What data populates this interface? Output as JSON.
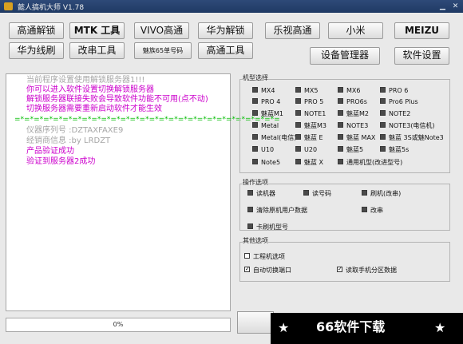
{
  "window": {
    "title": "懿人搞机大师 V1.78",
    "controls": [
      "minimize-icon",
      "close-icon"
    ]
  },
  "toolbar_row1": [
    "高通解锁",
    "MTK 工具",
    "VIVO高通",
    "华为解锁",
    "乐视高通",
    "小米",
    "MEIZU"
  ],
  "toolbar_row2": [
    "华为线刷",
    "改串工具",
    "魅族65单号码",
    "高通工具"
  ],
  "right_buttons": {
    "device_manager": "设备管理器",
    "settings": "软件设置"
  },
  "log": {
    "lines": [
      {
        "text": "当前程序设置使用解锁服务器1!!!",
        "color": "#a6a6a6"
      },
      {
        "text": "你可以进入软件设置切换解锁服务器",
        "color": "#cc00cc"
      },
      {
        "text": "解锁服务器联接失败会导致软件功能不可用(点不动)",
        "color": "#cc00cc"
      },
      {
        "text": "切换服务器需要重新启动软件才能生效",
        "color": "#cc00cc"
      },
      {
        "text": "=*=*=*=*=*=*=*=*=*=*=*=*=*=*=*=*=*=*=*=*=*=*=*=*=*=*=*=",
        "color": "#00bb00"
      },
      {
        "text": "仪器序列号   :DZTAXFAXE9",
        "color": "#a6a6a6"
      },
      {
        "text": "经销商信息   :by LRDZT",
        "color": "#a6a6a6"
      },
      {
        "text": "产品验证成功",
        "color": "#cc00cc"
      },
      {
        "text": "验证到服务器2成功",
        "color": "#cc00cc"
      }
    ]
  },
  "progress": {
    "label": "0%",
    "value": 0
  },
  "groups": {
    "models": {
      "label": "机型选择",
      "rows": [
        [
          "MX4",
          "MX5",
          "MX6",
          "PRO 6"
        ],
        [
          "PRO 4",
          "PRO 5",
          "PRO6s",
          "Pro6 Plus"
        ],
        [
          "魅蓝M1",
          "NOTE1",
          "魅蓝M2",
          "NOTE2"
        ],
        [
          "Metal",
          "魅蓝M3",
          "NOTE3",
          "NOTE3(电信机)"
        ],
        [
          "Metal(电信)",
          "魅蓝 E",
          "魅蓝 MAX",
          "魅蓝 3S或魅Note3"
        ],
        [
          "U10",
          "U20",
          "魅蓝5",
          "魅蓝5s"
        ],
        [
          "Note5",
          "魅蓝 X",
          "通用机型(改进型号)"
        ]
      ]
    },
    "operations": {
      "label": "操作选项",
      "items": [
        "读机器",
        "读号码",
        "刷机(改串)",
        "清除原机用户数据",
        "改串",
        "卡刷机型号"
      ]
    },
    "others": {
      "label": "其他选项",
      "items": [
        "工程机选项",
        "自动切换端口",
        "读取手机分区数据"
      ],
      "checked": [
        false,
        true,
        true
      ]
    }
  },
  "watermark": {
    "star": "★",
    "text": "66软件下载"
  },
  "colors": {
    "titlebar": "#2e4a78",
    "window_bg": "#e9e9e9",
    "log_gray": "#a6a6a6",
    "log_magenta": "#cc00cc",
    "log_green": "#00bb00"
  }
}
